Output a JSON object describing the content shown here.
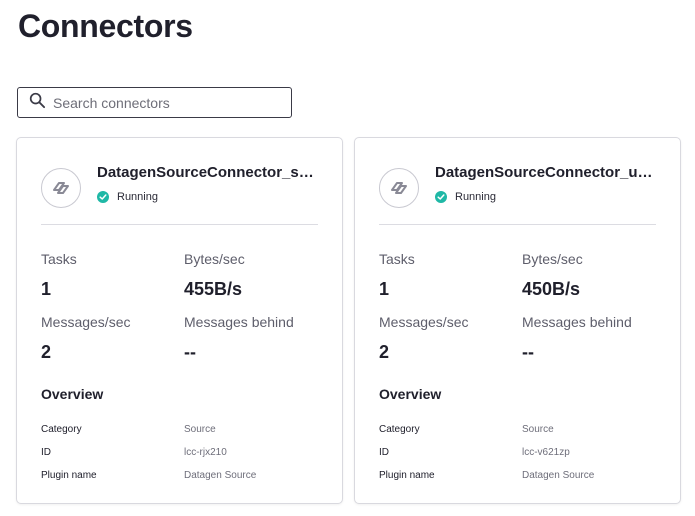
{
  "page": {
    "title": "Connectors"
  },
  "search": {
    "placeholder": "Search connectors",
    "value": ""
  },
  "colors": {
    "status_running": "#1fb8a6",
    "text_primary": "#20202c",
    "text_muted": "#5e5e6b"
  },
  "cards": [
    {
      "name": "DatagenSourceConnector_sto...",
      "status": "Running",
      "metrics": {
        "tasks_label": "Tasks",
        "tasks_value": "1",
        "bytes_label": "Bytes/sec",
        "bytes_value": "455B/s",
        "messages_label": "Messages/sec",
        "messages_value": "2",
        "behind_label": "Messages behind",
        "behind_value": "--"
      },
      "overview": {
        "title": "Overview",
        "category_label": "Category",
        "category_value": "Source",
        "id_label": "ID",
        "id_value": "lcc-rjx210",
        "plugin_label": "Plugin name",
        "plugin_value": "Datagen Source"
      }
    },
    {
      "name": "DatagenSourceConnector_users",
      "status": "Running",
      "metrics": {
        "tasks_label": "Tasks",
        "tasks_value": "1",
        "bytes_label": "Bytes/sec",
        "bytes_value": "450B/s",
        "messages_label": "Messages/sec",
        "messages_value": "2",
        "behind_label": "Messages behind",
        "behind_value": "--"
      },
      "overview": {
        "title": "Overview",
        "category_label": "Category",
        "category_value": "Source",
        "id_label": "ID",
        "id_value": "lcc-v621zp",
        "plugin_label": "Plugin name",
        "plugin_value": "Datagen Source"
      }
    }
  ]
}
